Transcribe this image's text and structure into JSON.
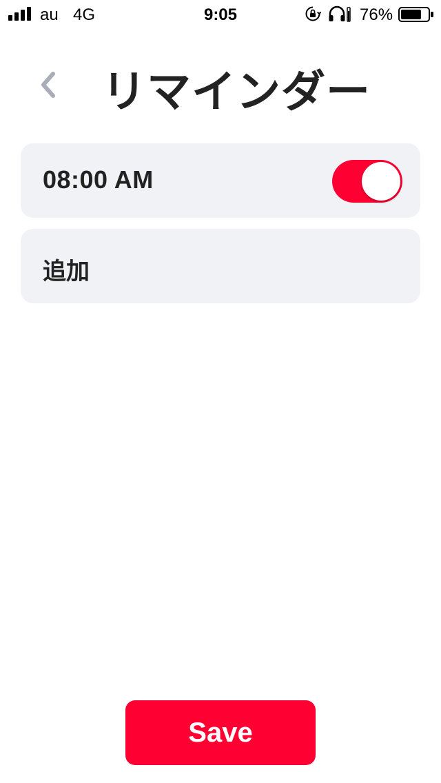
{
  "status_bar": {
    "carrier": "au",
    "network": "4G",
    "time": "9:05",
    "battery_percent": "76%",
    "battery_level": 0.76,
    "signal_bars": 4,
    "icons": [
      "rotation-lock-icon",
      "headphones-icon",
      "battery-icon"
    ]
  },
  "header": {
    "back_icon": "chevron-left-icon",
    "title": "リマインダー"
  },
  "reminders": [
    {
      "time": "08:00 AM",
      "enabled": true
    }
  ],
  "add": {
    "label": "追加"
  },
  "footer": {
    "save_label": "Save"
  },
  "colors": {
    "accent": "#ff0033",
    "card_background": "#f1f2f6",
    "text": "#222222",
    "back_icon": "#a9adb8"
  }
}
